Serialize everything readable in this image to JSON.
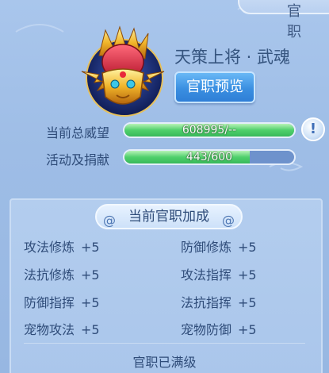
{
  "header": {
    "title_partial": "官 职"
  },
  "rank": {
    "name": "天策上将 · 武魂",
    "emblem_icon": "golden-helmet-emblem-icon"
  },
  "buttons": {
    "preview_label": "官职预览",
    "info_label": "!"
  },
  "stats": [
    {
      "label": "当前总威望",
      "value_text": "608995/--",
      "fill": 1.0
    },
    {
      "label": "活动及捐献",
      "value_text": "443/600",
      "fill": 0.738
    }
  ],
  "bonus": {
    "title": "当前官职加成",
    "items": [
      {
        "name": "攻法修炼",
        "value": "+5"
      },
      {
        "name": "防御修炼",
        "value": "+5"
      },
      {
        "name": "法抗修炼",
        "value": "+5"
      },
      {
        "name": "攻法指挥",
        "value": "+5"
      },
      {
        "name": "防御指挥",
        "value": "+5"
      },
      {
        "name": "法抗指挥",
        "value": "+5"
      },
      {
        "name": "宠物攻法",
        "value": "+5"
      },
      {
        "name": "宠物防御",
        "value": "+5"
      }
    ],
    "status": "官职已满级"
  },
  "colors": {
    "accent": "#3a8fe1",
    "bar_fill": "#4fd06c",
    "bar_track": "#6e92cc"
  }
}
